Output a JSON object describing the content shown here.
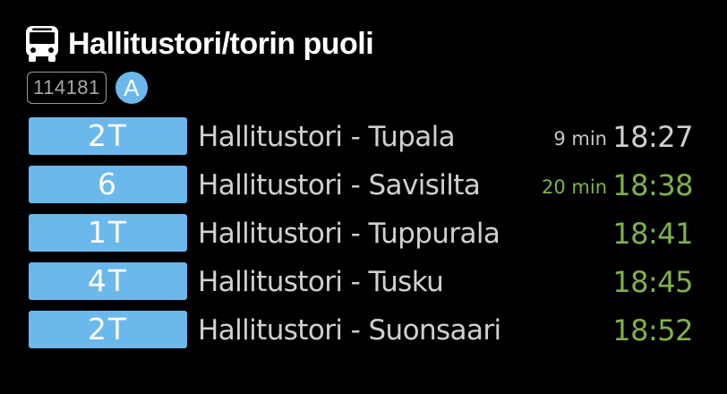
{
  "header": {
    "icon": "bus-icon",
    "title": "Hallitustori/torin puoli",
    "stop_code": "114181",
    "zone": "A"
  },
  "colors": {
    "route_badge": "#6bb8ec",
    "realtime_green": "#7fb24b",
    "scheduled_gray": "#d0d0d0"
  },
  "departures": [
    {
      "route": "2T",
      "destination": "Hallitustori - Tupala",
      "minutes": "9 min",
      "time": "18:27",
      "minutes_color": "gray",
      "time_color": "gray"
    },
    {
      "route": "6",
      "destination": "Hallitustori - Savisilta",
      "minutes": "20 min",
      "time": "18:38",
      "minutes_color": "green",
      "time_color": "green"
    },
    {
      "route": "1T",
      "destination": "Hallitustori - Tuppurala",
      "minutes": "",
      "time": "18:41",
      "minutes_color": "green",
      "time_color": "green"
    },
    {
      "route": "4T",
      "destination": "Hallitustori - Tusku",
      "minutes": "",
      "time": "18:45",
      "minutes_color": "green",
      "time_color": "green"
    },
    {
      "route": "2T",
      "destination": "Hallitustori - Suonsaari",
      "minutes": "",
      "time": "18:52",
      "minutes_color": "green",
      "time_color": "green"
    }
  ]
}
